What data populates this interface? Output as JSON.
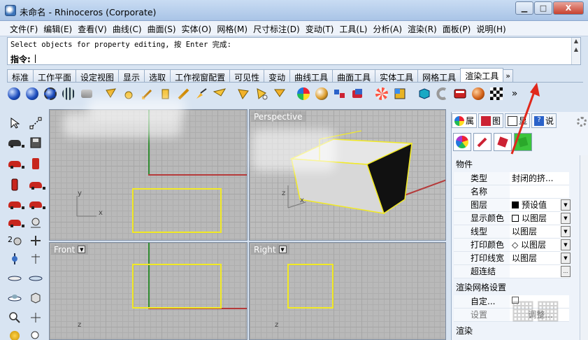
{
  "window": {
    "title": "未命名 - Rhinoceros (Corporate)",
    "buttons": [
      "▁",
      "□",
      "X"
    ]
  },
  "menu": [
    "文件(F)",
    "编辑(E)",
    "查看(V)",
    "曲线(C)",
    "曲面(S)",
    "实体(O)",
    "网格(M)",
    "尺寸标注(D)",
    "变动(T)",
    "工具(L)",
    "分析(A)",
    "渲染(R)",
    "面板(P)",
    "说明(H)"
  ],
  "command": {
    "history": "Select objects for property editing, 按 Enter 完成:",
    "prompt": "指令:"
  },
  "tabs": [
    "标准",
    "工作平面",
    "设定视图",
    "显示",
    "选取",
    "工作视窗配置",
    "可见性",
    "变动",
    "曲线工具",
    "曲面工具",
    "实体工具",
    "网格工具",
    "渲染工具"
  ],
  "tabs_active": "渲染工具",
  "tabs_more": "»",
  "toolbar_more": "»",
  "viewports": {
    "top_left": {
      "axis_y": "y",
      "axis_x": "x"
    },
    "perspective": {
      "label": "Perspective",
      "axis_y": "z",
      "axis_x": "x"
    },
    "front": {
      "label": "Front",
      "axis_y": "z"
    },
    "right": {
      "label": "Right",
      "axis_y": "z"
    }
  },
  "properties": {
    "tabs": [
      {
        "label": "属",
        "icon": "palette-icon"
      },
      {
        "label": "图",
        "icon": "layers-icon"
      },
      {
        "label": "显",
        "icon": "display-icon"
      },
      {
        "label": "说",
        "icon": "help-icon"
      }
    ],
    "section_object": "物件",
    "rows": [
      {
        "key": "类型",
        "value": "封闭的挤..."
      },
      {
        "key": "名称",
        "value": ""
      },
      {
        "key": "图层",
        "value": "预设值",
        "swatch": "#000000"
      },
      {
        "key": "显示颜色",
        "value": "以图层",
        "swatch": "#ffffff"
      },
      {
        "key": "线型",
        "value": "以图层"
      },
      {
        "key": "打印颜色",
        "value": "◇ 以图层"
      },
      {
        "key": "打印线宽",
        "value": "以图层"
      },
      {
        "key": "超连结",
        "value": ""
      }
    ],
    "section_mesh": "渲染网格设置",
    "mesh_rows": [
      {
        "key": "自定...",
        "value": ""
      },
      {
        "key": "设置",
        "value": "调整..."
      }
    ],
    "section_render": "渲染",
    "ellipsis": "..."
  },
  "colors": {
    "selection": "#f2ea24",
    "viewport_bg": "#b9b9b9",
    "axis_x": "#b53a3a",
    "axis_y": "#2f8a2f",
    "annotation_arrow": "#e0281c"
  }
}
